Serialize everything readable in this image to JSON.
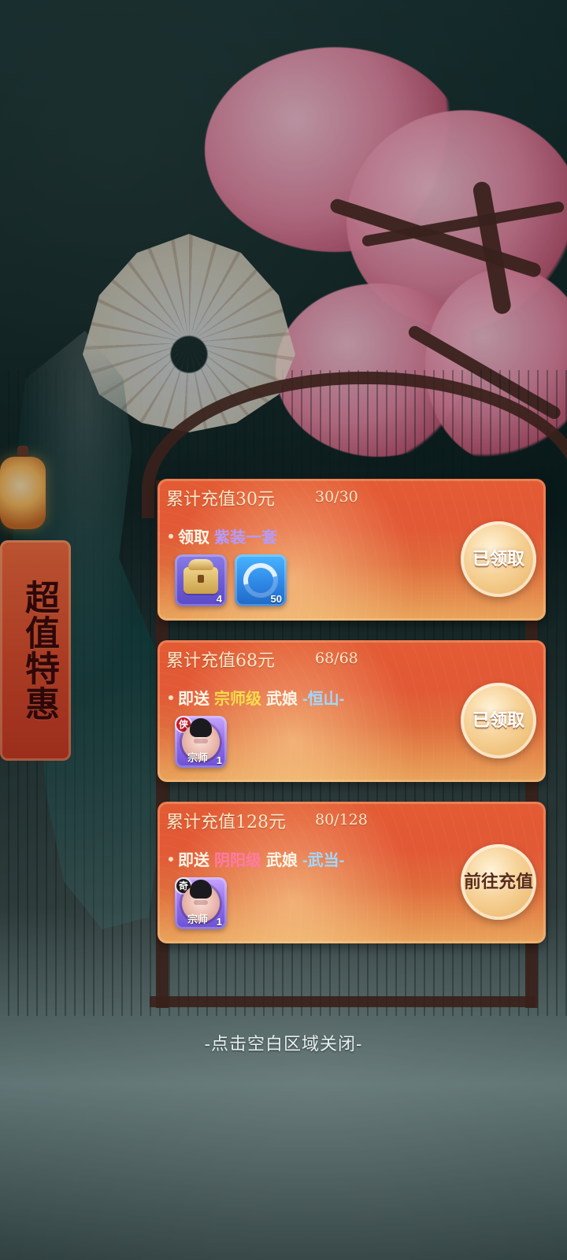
{
  "banner": {
    "text": "超值特惠"
  },
  "rewards": [
    {
      "title": "累计充值30元",
      "progress": "30/30",
      "line_prefix": "领取",
      "line_highlight": "紫装一套",
      "items": [
        {
          "icon": "chest-icon",
          "count": "4"
        },
        {
          "icon": "swirl-icon",
          "count": "50"
        }
      ],
      "button": "已领取"
    },
    {
      "title": "累计充值68元",
      "progress": "68/68",
      "line_prefix": "即送",
      "line_rank": "宗师级",
      "line_name_prefix": "武娘",
      "line_name": "-恒山-",
      "items": [
        {
          "icon": "portrait-icon",
          "count": "1",
          "badge": "侠",
          "stamp": "宗师"
        }
      ],
      "button": "已领取"
    },
    {
      "title": "累计充值128元",
      "progress": "80/128",
      "line_prefix": "即送",
      "line_rank": "阴阳级",
      "line_name_prefix": "武娘",
      "line_name": "-武当-",
      "items": [
        {
          "icon": "portrait-icon",
          "count": "1",
          "badge": "奇",
          "stamp": "宗师"
        }
      ],
      "button": "前往充值"
    }
  ],
  "footer": {
    "close_hint": "-点击空白区域关闭-"
  },
  "colors": {
    "card_top": "#e35b33",
    "card_bottom": "#e9a55c",
    "purple": "#b39bff",
    "yellow": "#f7dd4b",
    "pink": "#ff7aa6",
    "blue": "#9ed9ff"
  }
}
